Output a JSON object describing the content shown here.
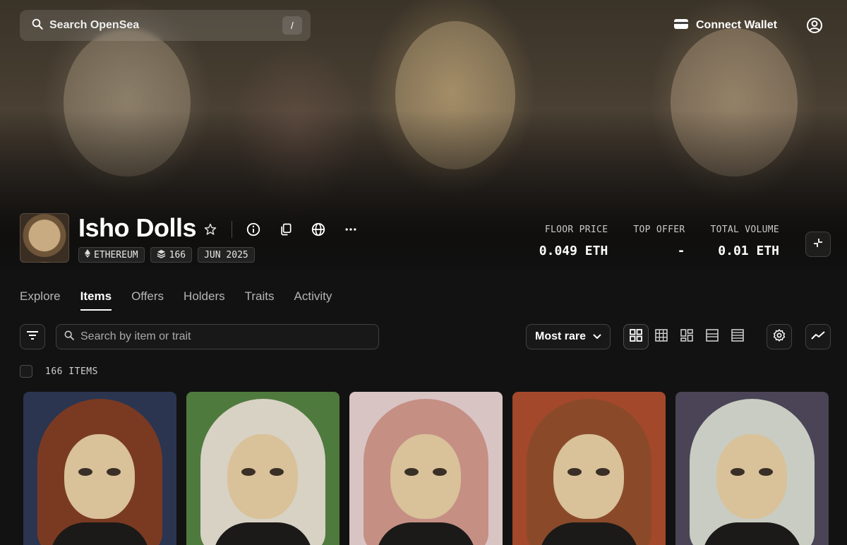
{
  "header": {
    "search_placeholder": "Search OpenSea",
    "search_shortcut": "/",
    "connect_wallet": "Connect Wallet"
  },
  "collection": {
    "name": "Isho Dolls",
    "chips": {
      "chain": "ETHEREUM",
      "items": "166",
      "date": "JUN 2025"
    },
    "stats": [
      {
        "label": "FLOOR PRICE",
        "value": "0.049 ETH"
      },
      {
        "label": "TOP OFFER",
        "value": "-"
      },
      {
        "label": "TOTAL VOLUME",
        "value": "0.01 ETH"
      }
    ]
  },
  "tabs": [
    {
      "label": "Explore"
    },
    {
      "label": "Items"
    },
    {
      "label": "Offers"
    },
    {
      "label": "Holders"
    },
    {
      "label": "Traits"
    },
    {
      "label": "Activity"
    }
  ],
  "active_tab": "Items",
  "toolbar": {
    "item_search_placeholder": "Search by item or trait",
    "sort_label": "Most rare"
  },
  "items_count": "166 ITEMS",
  "colors": {
    "background": "#121212",
    "text": "#ffffff",
    "muted": "#b5b5b5"
  },
  "cards": [
    {
      "hair": "#7a3a22",
      "bg": "#2b3550"
    },
    {
      "hair": "#d8d2c4",
      "bg": "#4f7a3e"
    },
    {
      "hair": "#c58f84",
      "bg": "#d9c4c4"
    },
    {
      "hair": "#8a4a2a",
      "bg": "#a3482a"
    },
    {
      "hair": "#c9ccc2",
      "bg": "#4a4456"
    }
  ]
}
